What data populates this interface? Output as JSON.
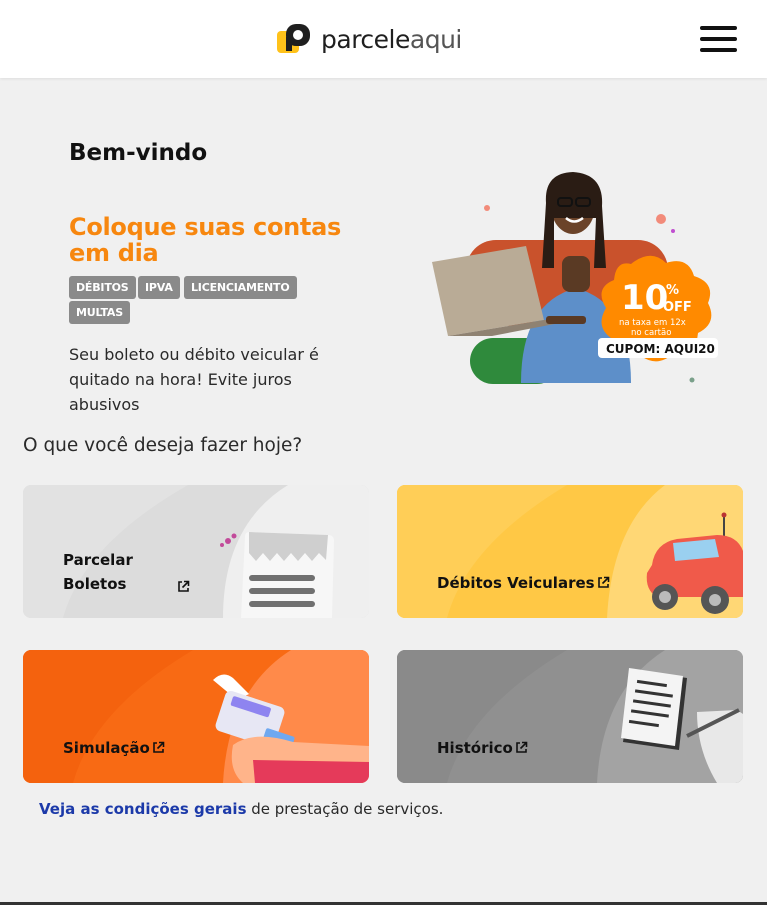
{
  "header": {
    "logo_text_a": "parcele",
    "logo_text_b": "aqui",
    "menu_icon": "hamburger-menu-icon"
  },
  "hero": {
    "welcome": "Bem-vindo",
    "headline": "Coloque suas contas em dia",
    "tags": [
      "DÉBITOS",
      "IPVA",
      "LICENCIAMENTO",
      "MULTAS"
    ],
    "description": "Seu boleto ou débito veicular é quitado na hora! Evite juros abusivos",
    "promo": {
      "percent": "10",
      "percent_sign": "%",
      "off": "OFF",
      "line1": "na taxa em 12x",
      "line2": "no cartão",
      "coupon": "CUPOM: AQUI20"
    }
  },
  "main": {
    "question": "O que você deseja fazer hoje?",
    "cards": [
      {
        "line1": "Parcelar",
        "line2": "Boletos",
        "color": "#dcdcdc"
      },
      {
        "label": "Débitos Veiculares",
        "color": "#ffc845"
      },
      {
        "label": "Simulação",
        "color": "#f86a14"
      },
      {
        "label": "Histórico",
        "color": "#909090"
      }
    ]
  },
  "footer": {
    "link_text": "Veja as condições gerais",
    "rest_text": " de prestação de serviços."
  },
  "colors": {
    "accent_orange": "#f7870f",
    "link_blue": "#1c3aa9",
    "tag_gray": "#8a8a8a"
  }
}
